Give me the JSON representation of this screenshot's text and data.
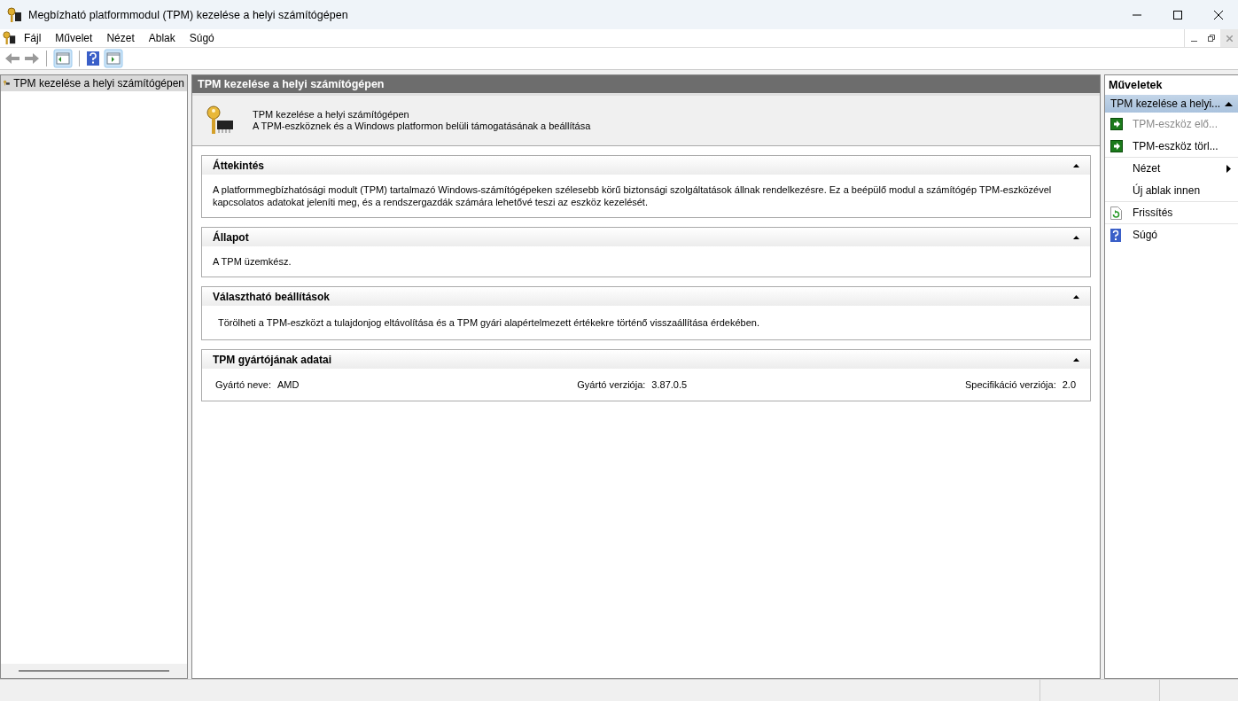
{
  "window": {
    "title": "Megbízható platformmodul (TPM) kezelése a helyi számítógépen"
  },
  "menu": [
    {
      "label": "Fájl"
    },
    {
      "label": "Művelet"
    },
    {
      "label": "Nézet"
    },
    {
      "label": "Ablak"
    },
    {
      "label": "Súgó"
    }
  ],
  "tree": {
    "items": [
      {
        "label": "TPM kezelése a helyi számítógépen",
        "selected": true
      }
    ]
  },
  "content": {
    "header": "TPM kezelése a helyi számítógépen",
    "intro_title": "TPM kezelése a helyi számítógépen",
    "intro_subtitle": "A TPM-eszköznek és a Windows platformon belüli támogatásának a beállítása",
    "sections": [
      {
        "title": "Áttekintés",
        "expanded": true,
        "kind": "text",
        "text": "A platformmegbízhatósági modult (TPM) tartalmazó Windows-számítógépeken szélesebb körű biztonsági szolgáltatások állnak rendelkezésre. Ez a beépülő modul a számítógép TPM-eszközével kapcsolatos adatokat jeleníti meg, és a rendszergazdák számára lehetővé teszi az eszköz kezelését."
      },
      {
        "title": "Állapot",
        "expanded": true,
        "kind": "text",
        "text": "A TPM üzemkész."
      },
      {
        "title": "Választható beállítások",
        "expanded": true,
        "kind": "indented",
        "text": "Törölheti a TPM-eszközt a tulajdonjog eltávolítása és a TPM gyári alapértelmezett értékekre történő visszaállítása érdekében."
      },
      {
        "title": "TPM gyártójának adatai",
        "expanded": true,
        "kind": "fields",
        "fields": [
          {
            "label": "Gyártó neve:",
            "value": "AMD"
          },
          {
            "label": "Gyártó verziója:",
            "value": "3.87.0.5"
          },
          {
            "label": "Specifikáció verziója:",
            "value": "2.0"
          }
        ]
      }
    ]
  },
  "actions": {
    "title": "Műveletek",
    "group": {
      "label": "TPM kezelése a helyi...",
      "expanded": true,
      "selected": true
    },
    "items": [
      {
        "label": "TPM-eszköz elő...",
        "kind": "arrow",
        "disabled": true,
        "submenu": false,
        "separator_before": false
      },
      {
        "label": "TPM-eszköz törl...",
        "kind": "arrow",
        "disabled": false,
        "submenu": false,
        "separator_before": false
      },
      {
        "label": "Nézet",
        "kind": "plain",
        "disabled": false,
        "submenu": true,
        "separator_before": true
      },
      {
        "label": "Új ablak innen",
        "kind": "plain",
        "disabled": false,
        "submenu": false,
        "separator_before": false
      },
      {
        "label": "Frissítés",
        "kind": "refresh",
        "disabled": false,
        "submenu": false,
        "separator_before": true
      },
      {
        "label": "Súgó",
        "kind": "help",
        "disabled": false,
        "submenu": false,
        "separator_before": true
      }
    ]
  }
}
